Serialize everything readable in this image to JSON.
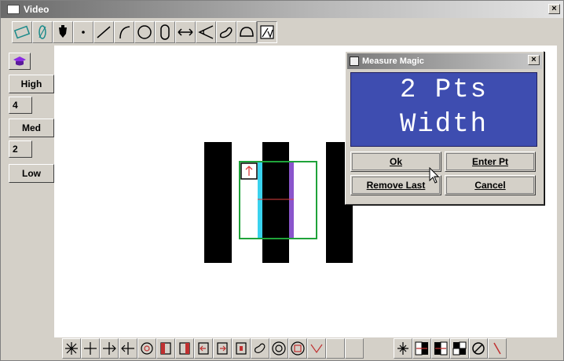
{
  "window": {
    "title": "Video",
    "close_glyph": "×"
  },
  "toolbar": {
    "icons": [
      "line-select-icon",
      "zero-icon",
      "probe-icon",
      "point-icon",
      "line-icon",
      "arc-icon",
      "circle-icon",
      "slot-icon",
      "width-icon",
      "angle-icon",
      "spline-icon",
      "arc-segment-icon",
      "measure-magic-icon"
    ]
  },
  "left_panel": {
    "high_label": "High",
    "high_value": "4",
    "med_label": "Med",
    "med_value": "2",
    "low_label": "Low"
  },
  "dialog": {
    "title": "Measure Magic",
    "close_glyph": "×",
    "display_line1": "2 Pts",
    "display_line2": "Width",
    "ok_label": "Ok",
    "enter_pt_label": "Enter Pt",
    "remove_last_label": "Remove Last",
    "cancel_label": "Cancel"
  },
  "colors": {
    "display_bg": "#3e4db0",
    "roi_green": "#1fa33a",
    "edge_cyan": "#3ad2ee",
    "edge_purple": "#8a55cc"
  }
}
